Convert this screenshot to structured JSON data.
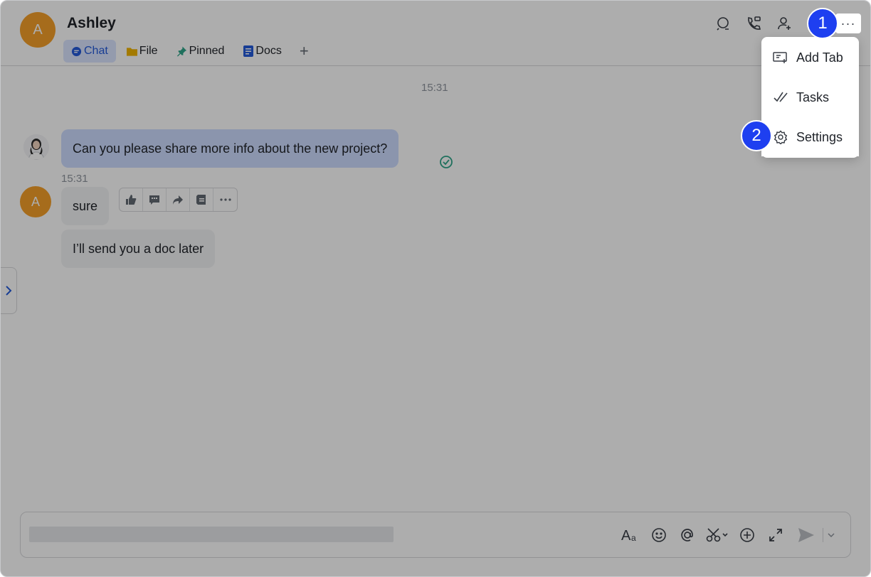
{
  "header": {
    "avatar_letter": "A",
    "title": "Ashley",
    "tabs": [
      {
        "label": "Chat",
        "icon": "chat-bubble-icon",
        "active": true
      },
      {
        "label": "File",
        "icon": "folder-icon"
      },
      {
        "label": "Pinned",
        "icon": "pin-icon"
      },
      {
        "label": "Docs",
        "icon": "docs-icon"
      }
    ],
    "add_tab_symbol": "+",
    "icons": [
      "search-chat-icon",
      "call-icon",
      "add-member-icon",
      "more-icon"
    ],
    "more_symbol": "···"
  },
  "messages": {
    "top_time": "15:31",
    "mid_time": "15:31",
    "sent_text": "Can you please share more info about the new project?",
    "reply_avatar_letter": "A",
    "reply_1": "sure",
    "reply_2": "I’ll send you a doc later"
  },
  "menu": {
    "items": [
      {
        "label": "Add Tab",
        "icon": "add-tab-icon"
      },
      {
        "label": "Tasks",
        "icon": "tasks-icon"
      },
      {
        "label": "Settings",
        "icon": "gear-icon"
      }
    ]
  },
  "steps": {
    "one": "1",
    "two": "2"
  },
  "colors": {
    "accent": "#245bdb",
    "step_badge": "#1e3ff0",
    "avatar": "#f5a02a",
    "sent_bubble": "#cddcff"
  }
}
